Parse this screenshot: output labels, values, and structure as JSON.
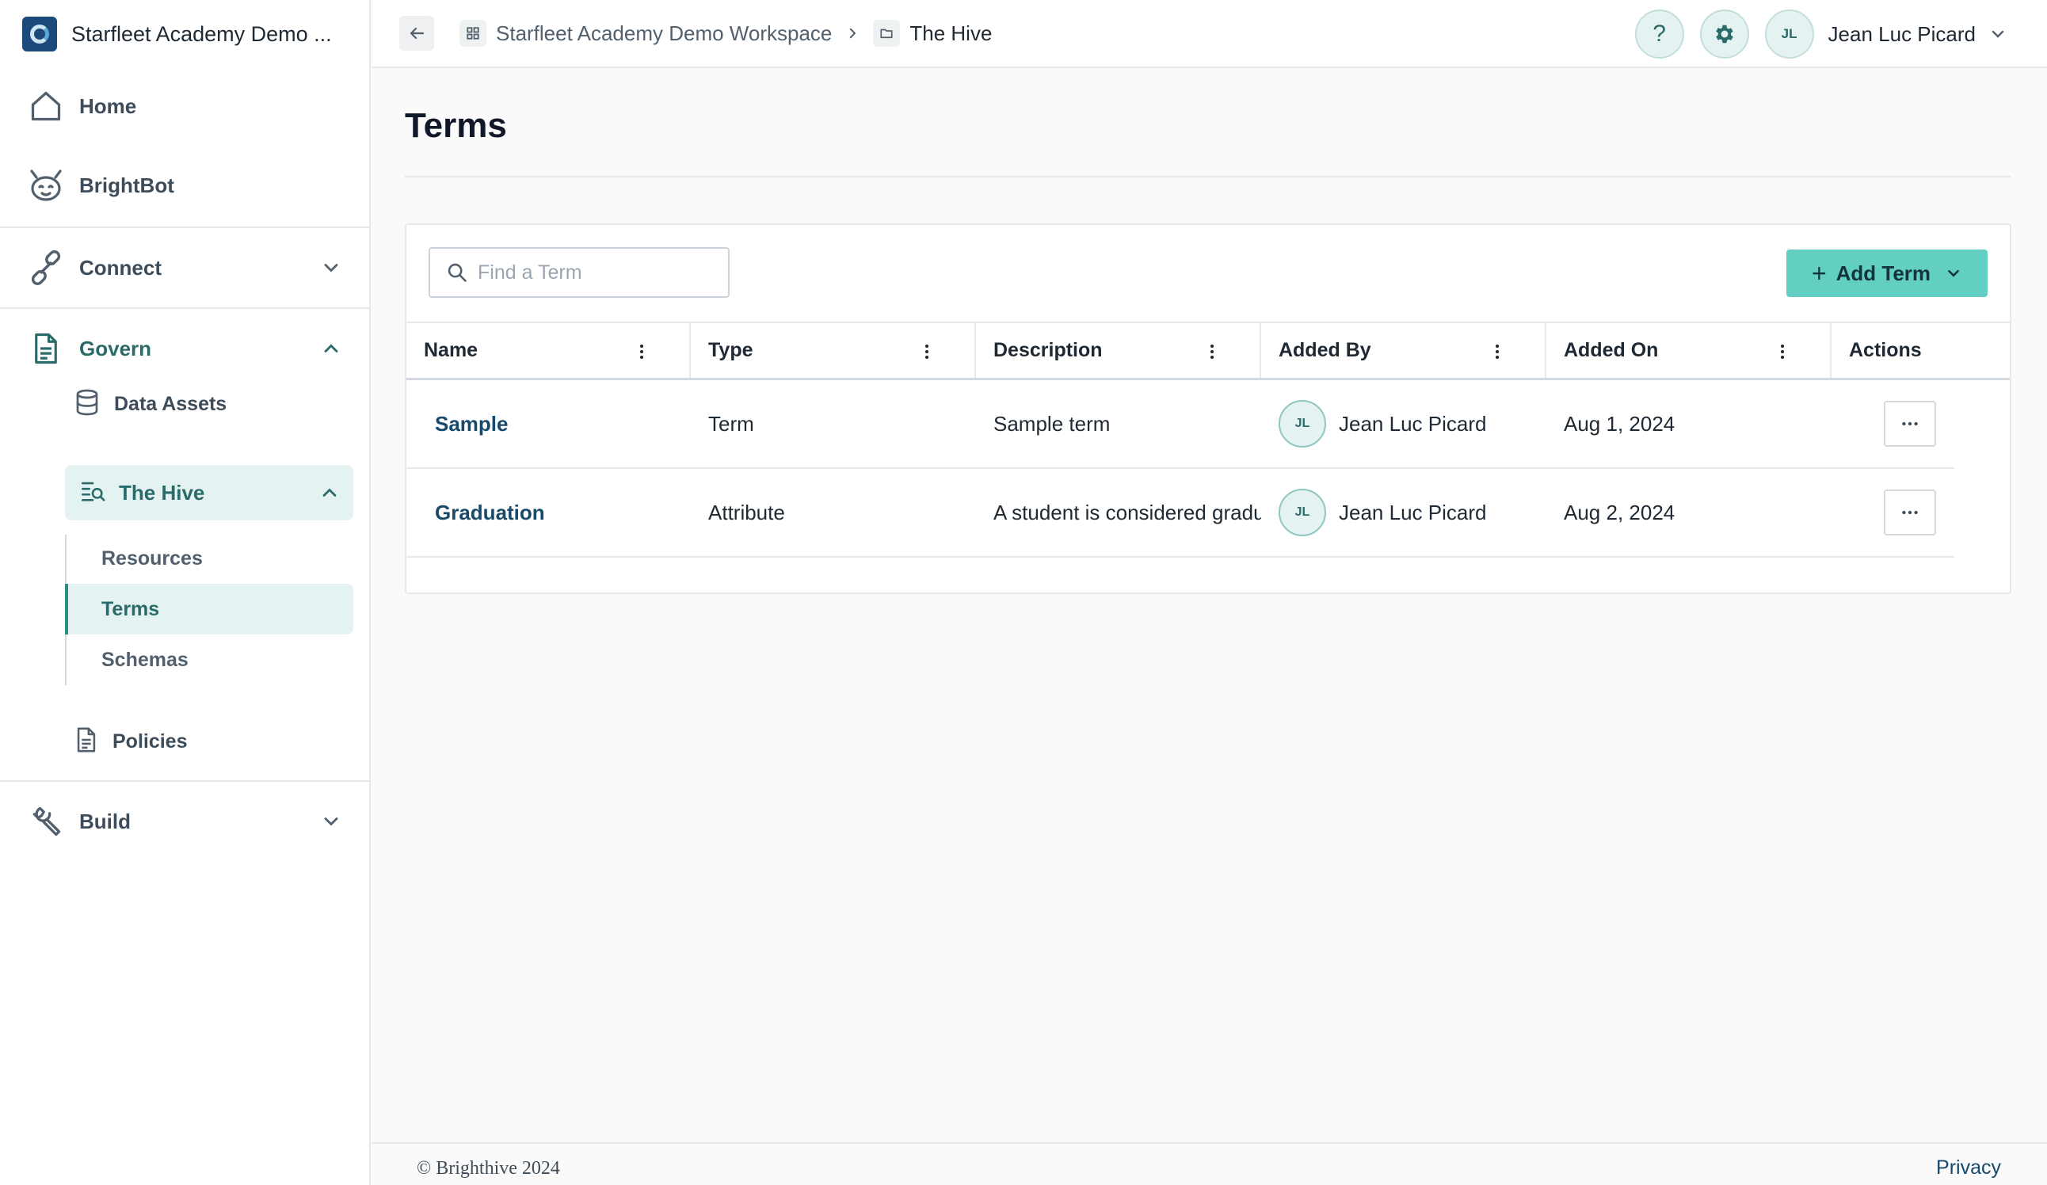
{
  "workspace": {
    "name": "Starfleet Academy Demo ..."
  },
  "sidebar": {
    "home": "Home",
    "brightbot": "BrightBot",
    "connect": "Connect",
    "govern": "Govern",
    "data_assets": "Data Assets",
    "the_hive": "The Hive",
    "resources": "Resources",
    "terms": "Terms",
    "schemas": "Schemas",
    "policies": "Policies",
    "build": "Build"
  },
  "breadcrumb": {
    "workspace": "Starfleet Academy Demo Workspace",
    "current": "The Hive"
  },
  "header": {
    "help": "?",
    "user_initials": "JL",
    "user_name": "Jean Luc Picard"
  },
  "page": {
    "title": "Terms",
    "search_placeholder": "Find a Term",
    "add_button": "Add Term"
  },
  "table": {
    "columns": [
      "Name",
      "Type",
      "Description",
      "Added By",
      "Added On",
      "Actions"
    ],
    "rows": [
      {
        "name": "Sample",
        "type": "Term",
        "description": "Sample term",
        "added_by_initials": "JL",
        "added_by": "Jean Luc Picard",
        "added_on": "Aug 1, 2024"
      },
      {
        "name": "Graduation",
        "type": "Attribute",
        "description": "A student is considered gradu",
        "added_by_initials": "JL",
        "added_by": "Jean Luc Picard",
        "added_on": "Aug 2, 2024"
      }
    ]
  },
  "footer": {
    "copyright": "© Brighthive 2024",
    "privacy": "Privacy"
  },
  "colors": {
    "accent": "#63cfc2",
    "accent_dark": "#2a6b6a",
    "link": "#17496b",
    "active_bg": "#e4f3f1"
  }
}
